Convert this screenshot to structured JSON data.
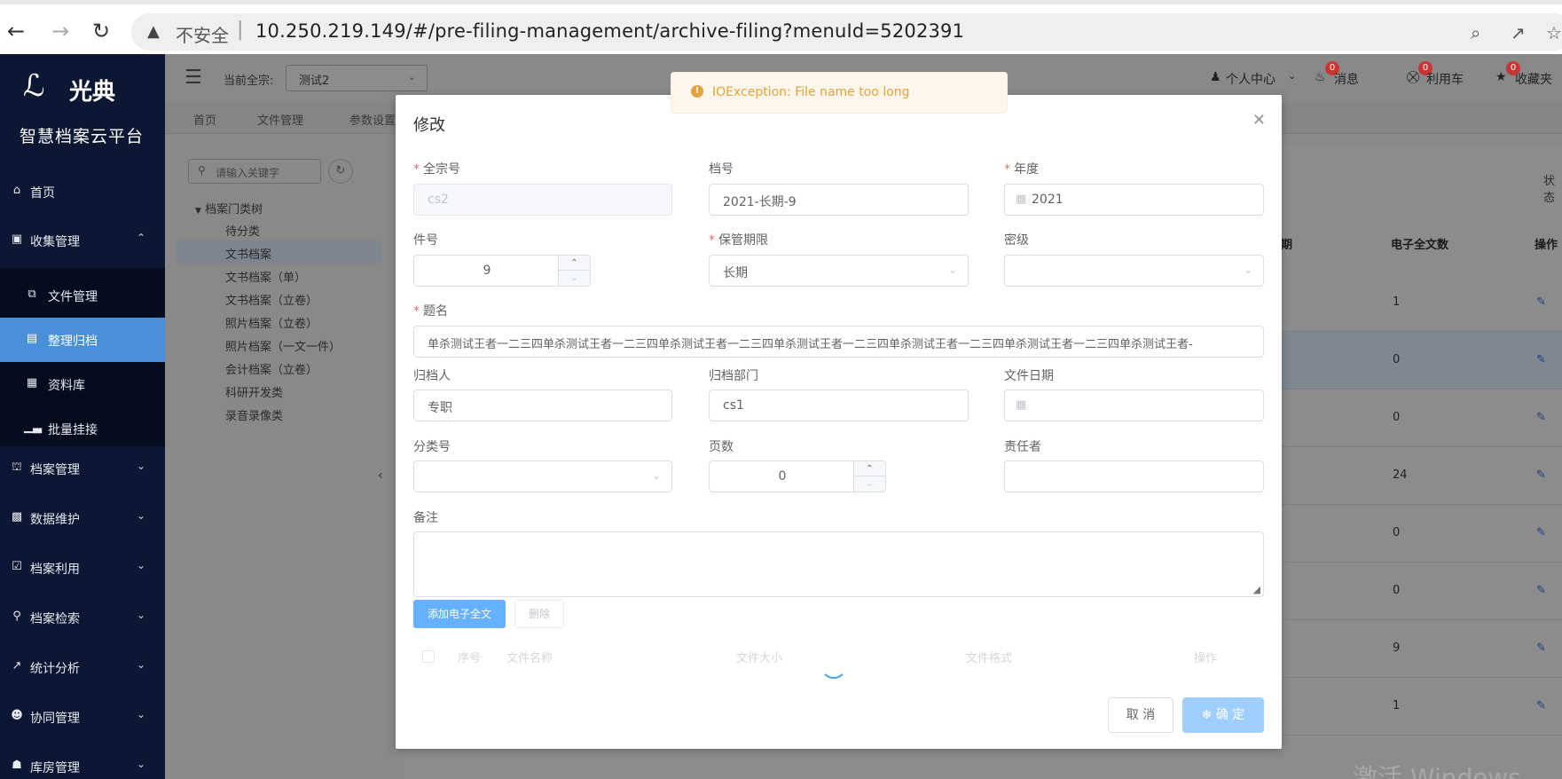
{
  "browser": {
    "insecure_label": "不安全",
    "url": "10.250.219.149/#/pre-filing-management/archive-filing?menuId=5202391"
  },
  "sidebar": {
    "brand_logo_text": "光典",
    "brand_name": "智慧档案云平台",
    "menu": [
      {
        "label": "首页",
        "icon": "home-icon"
      },
      {
        "label": "收集管理",
        "icon": "briefcase-icon",
        "expanded": true
      },
      {
        "label": "档案管理",
        "icon": "bank-icon"
      },
      {
        "label": "数据维护",
        "icon": "building-icon"
      },
      {
        "label": "档案利用",
        "icon": "calendar-check-icon"
      },
      {
        "label": "档案检索",
        "icon": "search-icon"
      },
      {
        "label": "统计分析",
        "icon": "chart-icon"
      },
      {
        "label": "协同管理",
        "icon": "users-icon"
      },
      {
        "label": "库房管理",
        "icon": "warehouse-icon"
      }
    ],
    "submenu": [
      {
        "label": "文件管理",
        "icon": "copy-icon"
      },
      {
        "label": "整理归档",
        "icon": "file-icon",
        "active": true
      },
      {
        "label": "资料库",
        "icon": "calendar-icon"
      },
      {
        "label": "批量挂接",
        "icon": "bar-chart-icon"
      }
    ]
  },
  "topbar": {
    "current_zong_label": "当前全宗:",
    "current_zong_value": "测试2",
    "personal_center": "个人中心",
    "messages": "消息",
    "messages_badge": "0",
    "cart": "利用车",
    "cart_badge": "0",
    "favorites": "收藏夹",
    "favorites_badge": "0"
  },
  "tabs": [
    "首页",
    "文件管理",
    "参数设置"
  ],
  "tree": {
    "search_placeholder": "请输入关键字",
    "root": "档案门类树",
    "nodes": [
      "待分类",
      "文书档案",
      "文书档案（单）",
      "文书档案（立卷）",
      "照片档案（立卷）",
      "照片档案（一文一件）",
      "会计档案（立卷）",
      "科研开发类",
      "录音录像类"
    ]
  },
  "main": {
    "state_label": "状态",
    "col_period_partial": "期",
    "col_digital_count": "电子全文数",
    "col_action": "操作",
    "row_counts": [
      "1",
      "0",
      "0",
      "24",
      "0",
      "0",
      "9",
      "1"
    ],
    "windows_watermark": "激活 Windows"
  },
  "toast": {
    "message": "IOException: File name too long",
    "color": "#e6a23c"
  },
  "modal": {
    "title": "修改",
    "fields": {
      "quanzong_label": "全宗号",
      "quanzong_value": "cs2",
      "danghao_label": "档号",
      "danghao_value": "2021-长期-9",
      "niandu_label": "年度",
      "niandu_value": "2021",
      "jianhao_label": "件号",
      "jianhao_value": "9",
      "baoguan_label": "保管期限",
      "baoguan_value": "长期",
      "miji_label": "密级",
      "miji_value": "",
      "timing_label": "题名",
      "timing_value": "单杀测试王者一二三四单杀测试王者一二三四单杀测试王者一二三四单杀测试王者一二三四单杀测试王者一二三四单杀测试王者一二三四单杀测试王者-",
      "guidangren_label": "归档人",
      "guidangren_value": "专职",
      "guidangbumen_label": "归档部门",
      "guidangbumen_value": "cs1",
      "wenjianriqi_label": "文件日期",
      "wenjianriqi_value": "",
      "fenleihao_label": "分类号",
      "fenleihao_value": "",
      "yeshu_label": "页数",
      "yeshu_value": "0",
      "zerenzhe_label": "责任者",
      "zerenzhe_value": "",
      "beizhu_label": "备注",
      "beizhu_value": ""
    },
    "add_file_button": "添加电子全文",
    "delete_button": "删除",
    "table_headers": [
      "序号",
      "文件名称",
      "文件大小",
      "文件格式",
      "操作"
    ],
    "cancel_button": "取 消",
    "confirm_button": "确 定",
    "primary_color": "#409eff"
  }
}
